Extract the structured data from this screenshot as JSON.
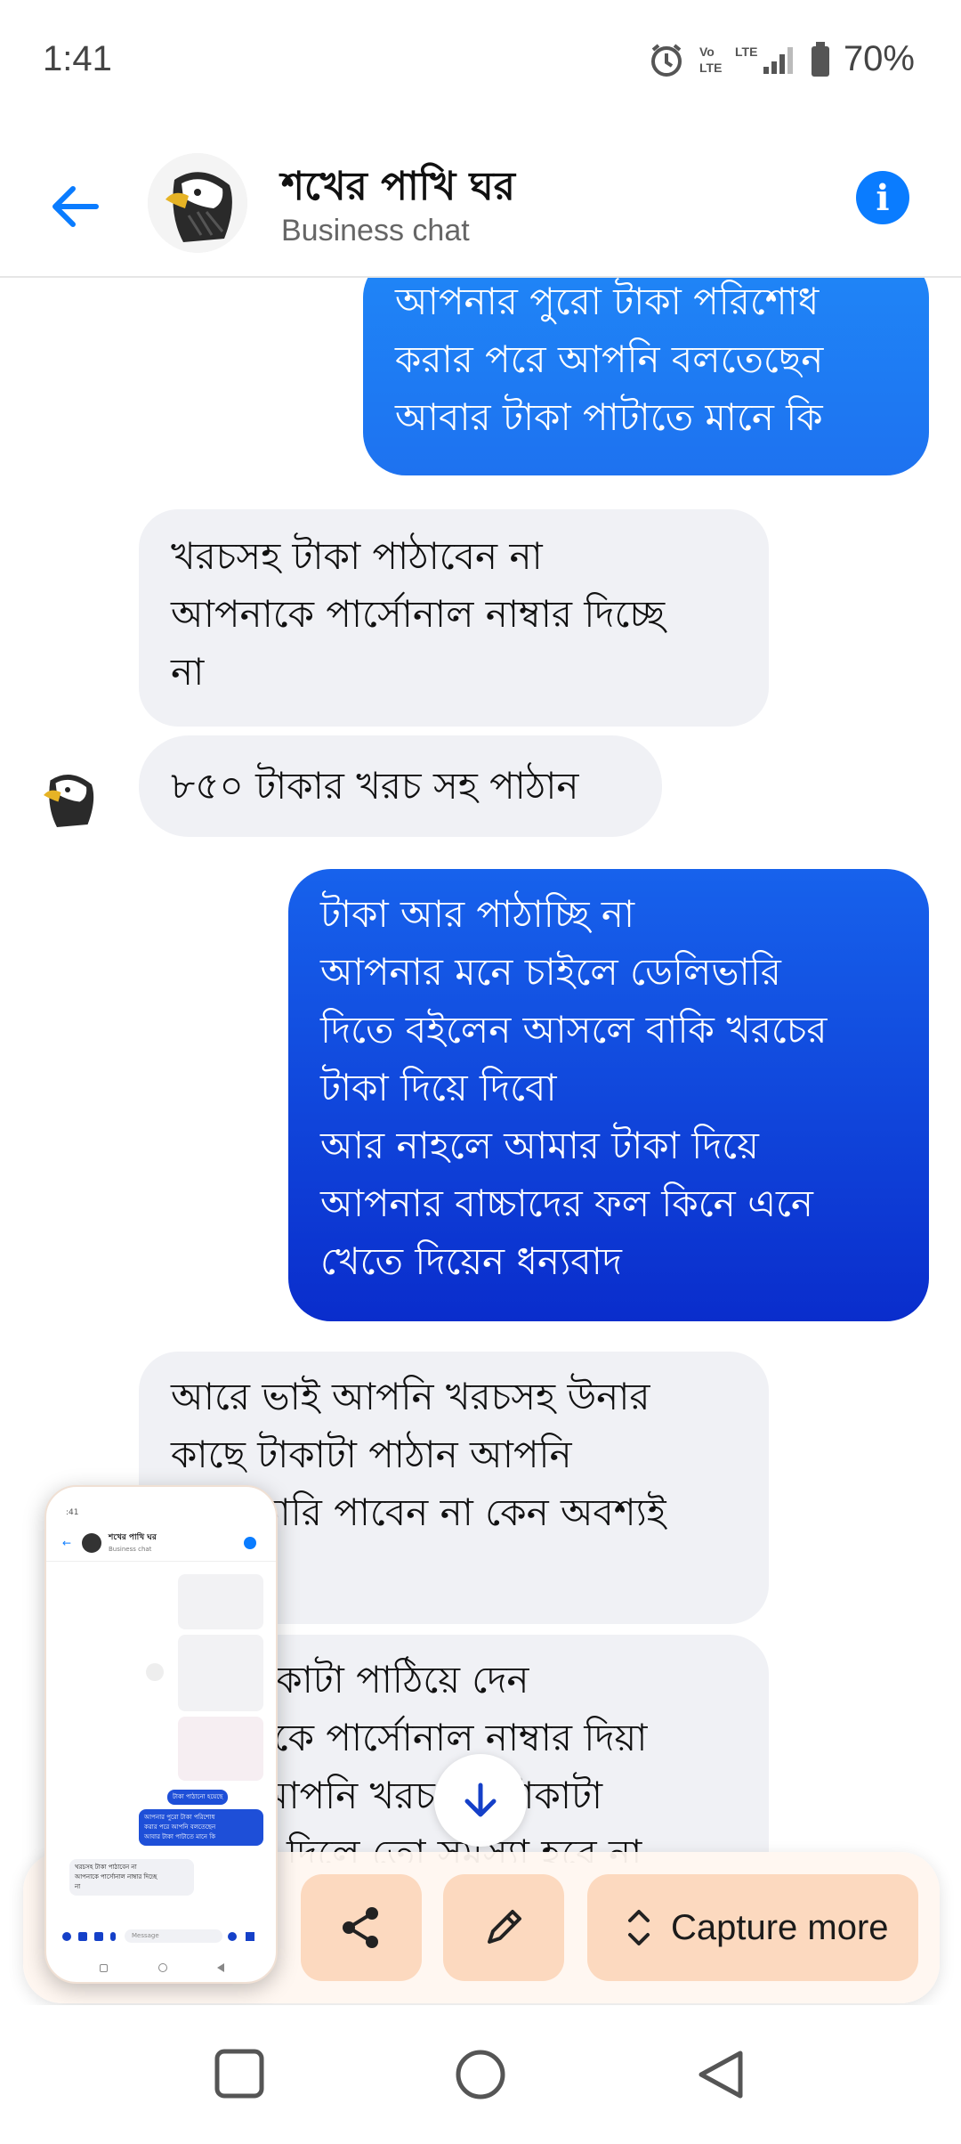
{
  "status_bar": {
    "time": "1:41",
    "battery": "70%",
    "icons": [
      "alarm-icon",
      "volte-icon",
      "lte-signal-icon",
      "battery-icon"
    ]
  },
  "header": {
    "title": "শখের পাখি ঘর",
    "subtitle": "Business chat",
    "icons": [
      "back-arrow-icon",
      "eagle-avatar",
      "info-icon"
    ],
    "accent": "#0a7cff"
  },
  "messages": [
    {
      "from": "me",
      "text": "আপনার পুরো টাকা পরিশোধ\nকরার পরে  আপনি বলতেছেন\nআবার টাকা পাটাতে মানে কি"
    },
    {
      "from": "them",
      "text": "খরচসহ টাকা পাঠাবেন না\nআপনাকে পার্সোনাল নাম্বার দিচ্ছে\nনা"
    },
    {
      "from": "them",
      "text": "৮৫০ টাকার খরচ সহ পাঠান"
    },
    {
      "from": "me",
      "text": "টাকা আর পাঠাচ্ছি না\nআপনার মনে চাইলে ডেলিভারি\nদিতে বইলেন আসলে বাকি খরচের\nটাকা দিয়ে দিবো\nআর নাহলে আমার টাকা দিয়ে\nআপনার বাচ্চাদের ফল কিনে এনে\nখেতে দিয়েন ধন্যবাদ"
    },
    {
      "from": "them",
      "text": "আরে ভাই আপনি খরচসহ উনার\nকাছে টাকাটা পাঠান আপনি\nডেলিভারি পাবেন না কেন অবশ্যই\nপাবেন"
    },
    {
      "from": "them",
      "text": "উনি টাকাটা পাঠিয়ে দেন\nআপনাকে পার্সোনাল নাম্বার দিয়া\nদিলে আপনি খরচ সহ টাকাটা\nপাঠিয়ে দিলে তো সমস্যা হবে না"
    }
  ],
  "colors": {
    "outgoing_top": "#1e78f5",
    "outgoing_bottom": "#0a2fd0",
    "incoming": "#f0f1f5"
  },
  "capture_toolbar": {
    "share_icon": "share-icon",
    "edit_icon": "pencil-icon",
    "capture_more_label": "Capture more",
    "capture_more_icon": "expand-vertical-icon",
    "button_color": "#fcd9bf"
  },
  "thumbnail": {
    "time": ":41",
    "title": "শখের পাখি ঘর",
    "subtitle": "Business chat",
    "sent_1": "টাকা পাঠানো হয়েছে",
    "sent_2": "আপনার পুরো টাকা পরিশোধ\nকরার পরে  আপনি বলতেছেন\nআবার টাকা পাটাতে মানে কি",
    "received_1": "খরচসহ টাকা পাঠাবেন না\nআপনাকে পার্সোনাল নাম্বার দিচ্ছে\nনা",
    "composer_placeholder": "Message"
  },
  "nav_bar": {
    "icons": [
      "recents-square-icon",
      "home-circle-icon",
      "back-triangle-icon"
    ]
  }
}
